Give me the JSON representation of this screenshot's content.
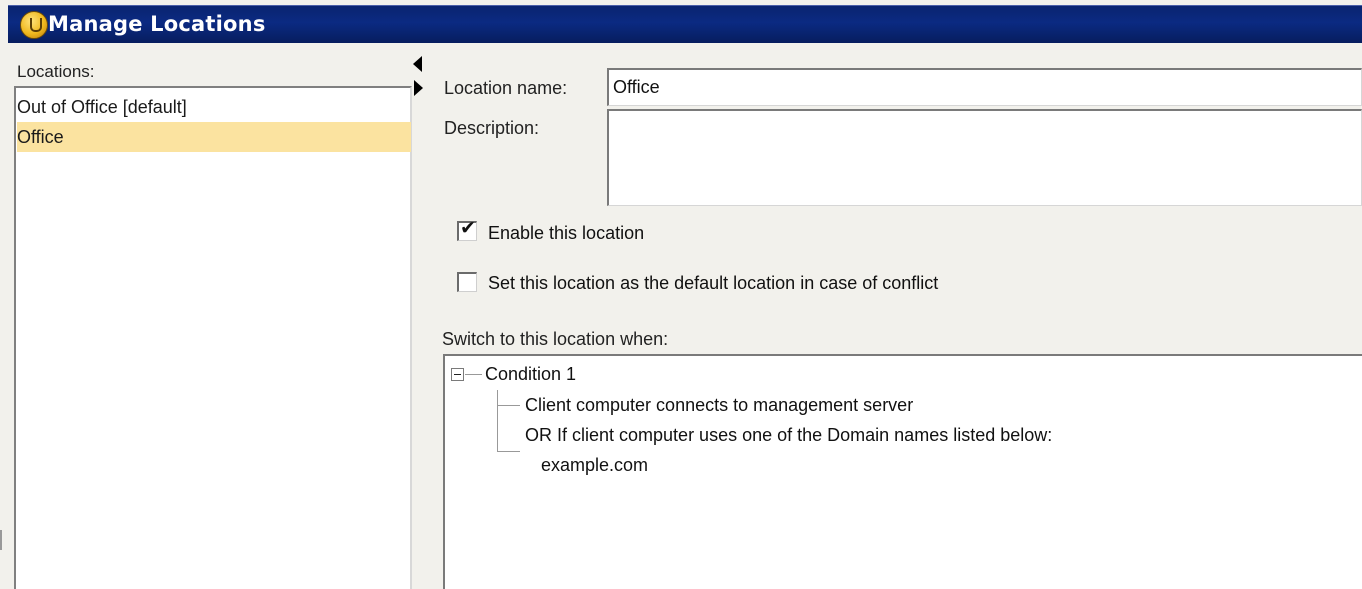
{
  "window": {
    "title": "Manage Locations",
    "title_icon": "shield-icon"
  },
  "locations_panel": {
    "label": "Locations:",
    "items": [
      {
        "label": "Out of Office [default]",
        "selected": false
      },
      {
        "label": "Office",
        "selected": true
      }
    ]
  },
  "details": {
    "location_name_label": "Location name:",
    "location_name_value": "Office",
    "description_label": "Description:",
    "description_value": "",
    "enable_checkbox": {
      "label": "Enable this location",
      "checked": true
    },
    "default_checkbox": {
      "label": "Set this location as the default location in case of conflict",
      "checked": false
    },
    "switch_label": "Switch to this location when:"
  },
  "conditions": {
    "condition_title": "Condition 1",
    "rules": [
      "Client computer connects to management server",
      "OR If client computer uses one of the Domain names listed below:"
    ],
    "domains": [
      "example.com"
    ]
  },
  "colors": {
    "titlebar": "#0b2a82",
    "selection": "#fbe3a0",
    "background": "#f2f1ec"
  }
}
